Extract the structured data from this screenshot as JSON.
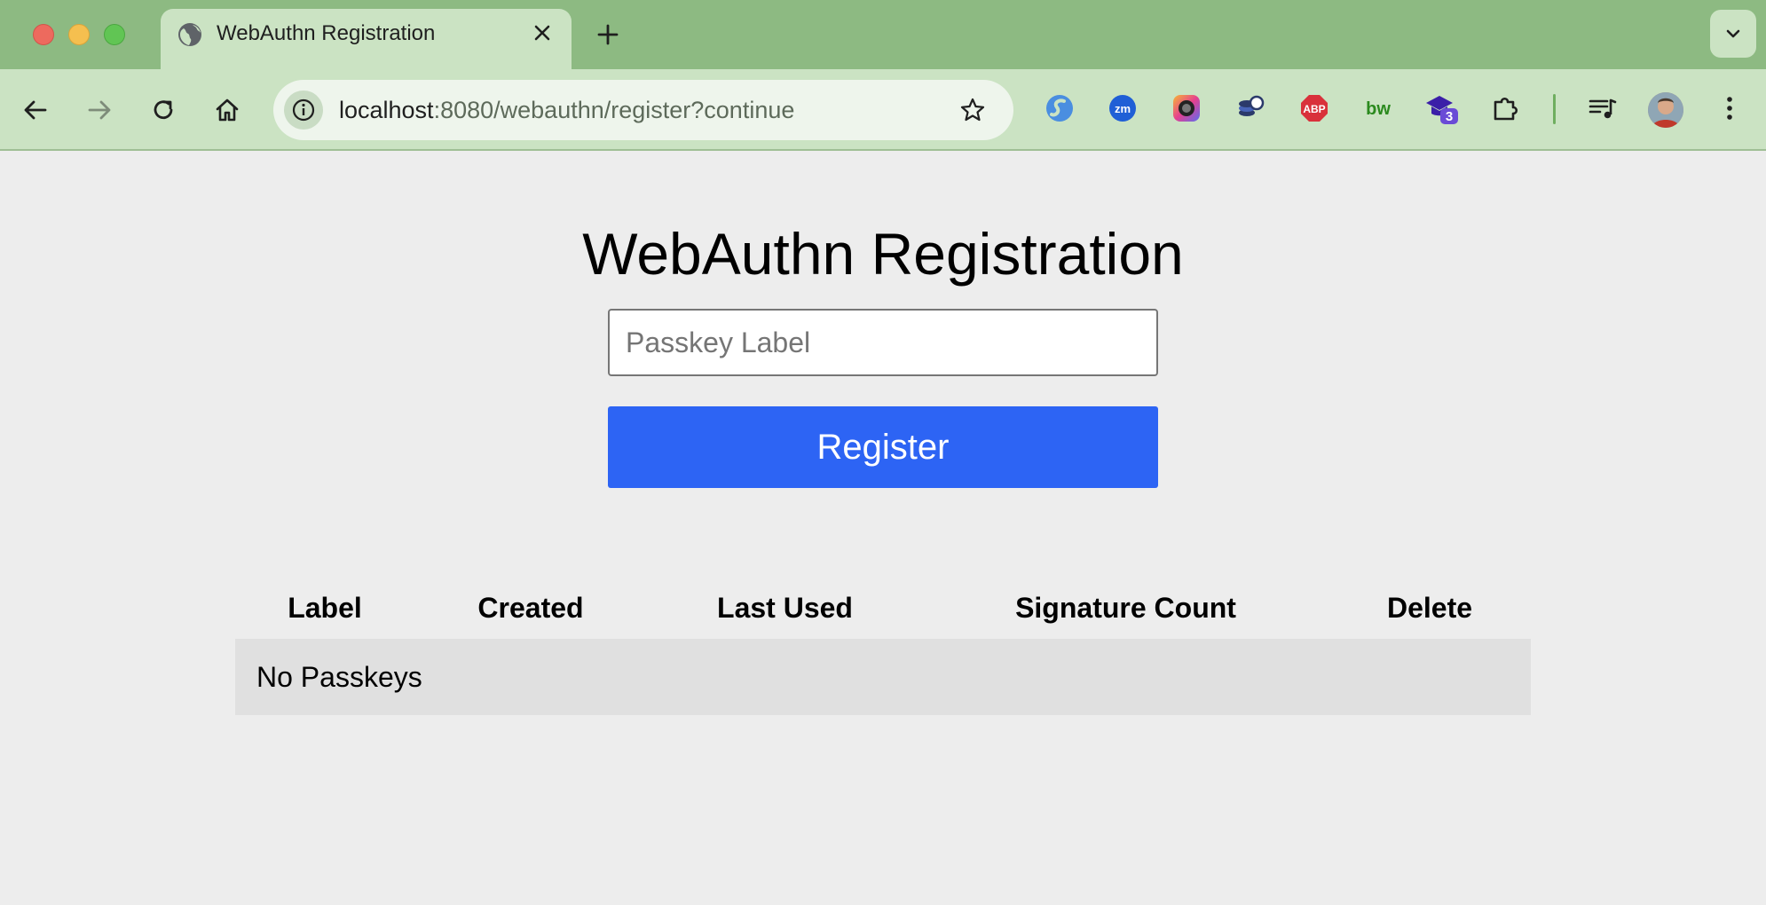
{
  "browser": {
    "tab": {
      "title": "WebAuthn Registration",
      "favicon": "globe-icon"
    },
    "address_bar": {
      "host": "localhost",
      "rest": ":8080/webauthn/register?continue"
    },
    "extensions": [
      "s-extension-icon",
      "zm-extension-icon",
      "camera-extension-icon",
      "coins-extension-icon",
      "adblock-plus-icon",
      "bw-extension-icon",
      "graduation-extension-icon",
      "puzzle-icon"
    ],
    "ext_abp_label": "ABP",
    "ext_bw_label": "bw",
    "ext_zm_label": "zm",
    "ext_badge": "3",
    "accent": "#2d64f4"
  },
  "page": {
    "title": "WebAuthn Registration",
    "label_input": {
      "placeholder": "Passkey Label",
      "value": ""
    },
    "register_label": "Register",
    "table": {
      "headers": [
        "Label",
        "Created",
        "Last Used",
        "Signature Count",
        "Delete"
      ],
      "empty_message": "No Passkeys"
    }
  }
}
